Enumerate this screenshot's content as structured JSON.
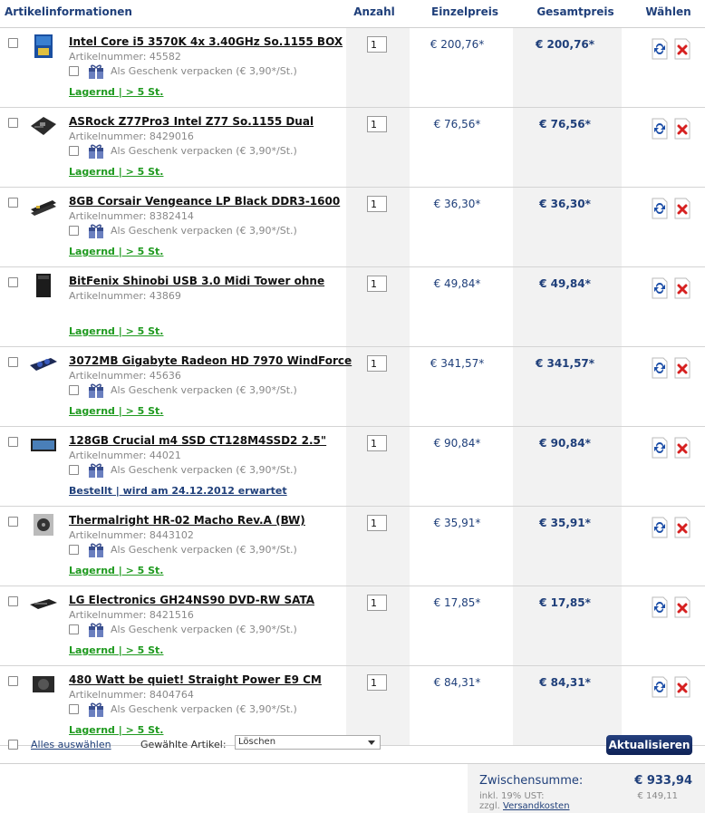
{
  "header": {
    "col_info": "Artikelinformationen",
    "col_qty": "Anzahl",
    "col_unit": "Einzelpreis",
    "col_total": "Gesamtpreis",
    "col_select": "Wählen"
  },
  "gift_text": "Als Geschenk verpacken (€ 3,90*/St.)",
  "items": [
    {
      "name": "Intel Core i5 3570K 4x 3.40GHz So.1155 BOX",
      "art": "Artikelnummer: 45582",
      "qty": "1",
      "unit": "€ 200,76*",
      "total": "€ 200,76*",
      "stock": "Lagernd | > 5 St.",
      "stock_type": "ok",
      "thumb": "cpu-box"
    },
    {
      "name": "ASRock Z77Pro3 Intel Z77 So.1155 Dual",
      "art": "Artikelnummer: 8429016",
      "qty": "1",
      "unit": "€ 76,56*",
      "total": "€ 76,56*",
      "stock": "Lagernd | > 5 St.",
      "stock_type": "ok",
      "thumb": "motherboard"
    },
    {
      "name": "8GB Corsair Vengeance LP Black DDR3-1600",
      "art": "Artikelnummer: 8382414",
      "qty": "1",
      "unit": "€ 36,30*",
      "total": "€ 36,30*",
      "stock": "Lagernd | > 5 St.",
      "stock_type": "ok",
      "thumb": "ram"
    },
    {
      "name": "BitFenix Shinobi USB 3.0 Midi Tower ohne",
      "art": "Artikelnummer: 43869",
      "qty": "1",
      "unit": "€ 49,84*",
      "total": "€ 49,84*",
      "stock": "Lagernd | > 5 St.",
      "stock_type": "ok",
      "thumb": "tower",
      "no_gift": true
    },
    {
      "name": "3072MB Gigabyte Radeon HD 7970 WindForce",
      "art": "Artikelnummer: 45636",
      "qty": "1",
      "unit": "€ 341,57*",
      "total": "€ 341,57*",
      "stock": "Lagernd | > 5 St.",
      "stock_type": "ok",
      "thumb": "gpu"
    },
    {
      "name": "128GB Crucial m4 SSD CT128M4SSD2 2.5\"",
      "art": "Artikelnummer: 44021",
      "qty": "1",
      "unit": "€ 90,84*",
      "total": "€ 90,84*",
      "stock": "Bestellt | wird am 24.12.2012 erwartet",
      "stock_type": "ord",
      "thumb": "ssd"
    },
    {
      "name": "Thermalright HR-02 Macho Rev.A (BW)",
      "art": "Artikelnummer: 8443102",
      "qty": "1",
      "unit": "€ 35,91*",
      "total": "€ 35,91*",
      "stock": "Lagernd | > 5 St.",
      "stock_type": "ok",
      "thumb": "cooler"
    },
    {
      "name": "LG Electronics GH24NS90 DVD-RW SATA",
      "art": "Artikelnummer: 8421516",
      "qty": "1",
      "unit": "€ 17,85*",
      "total": "€ 17,85*",
      "stock": "Lagernd | > 5 St.",
      "stock_type": "ok",
      "thumb": "dvd"
    },
    {
      "name": "480 Watt be quiet! Straight Power E9 CM",
      "art": "Artikelnummer: 8404764",
      "qty": "1",
      "unit": "€ 84,31*",
      "total": "€ 84,31*",
      "stock": "Lagernd | > 5 St.",
      "stock_type": "ok",
      "thumb": "psu"
    }
  ],
  "footer": {
    "select_all": "Alles auswählen",
    "chosen_label": "Gewählte Artikel:",
    "action_selected": "Löschen",
    "update_button": "Aktualisieren"
  },
  "summary": {
    "subtotal_label": "Zwischensumme:",
    "subtotal_value": "€ 933,94",
    "tax_label": "inkl. 19% UST:",
    "tax_value": "€ 149,11",
    "ship_prefix": "zzgl.",
    "ship_link": "Versandkosten"
  },
  "colors": {
    "accent": "#1f3f7a",
    "stock_ok": "#1f9a1f",
    "delete_red": "#d62020",
    "update_blue": "#1d4fa8"
  }
}
